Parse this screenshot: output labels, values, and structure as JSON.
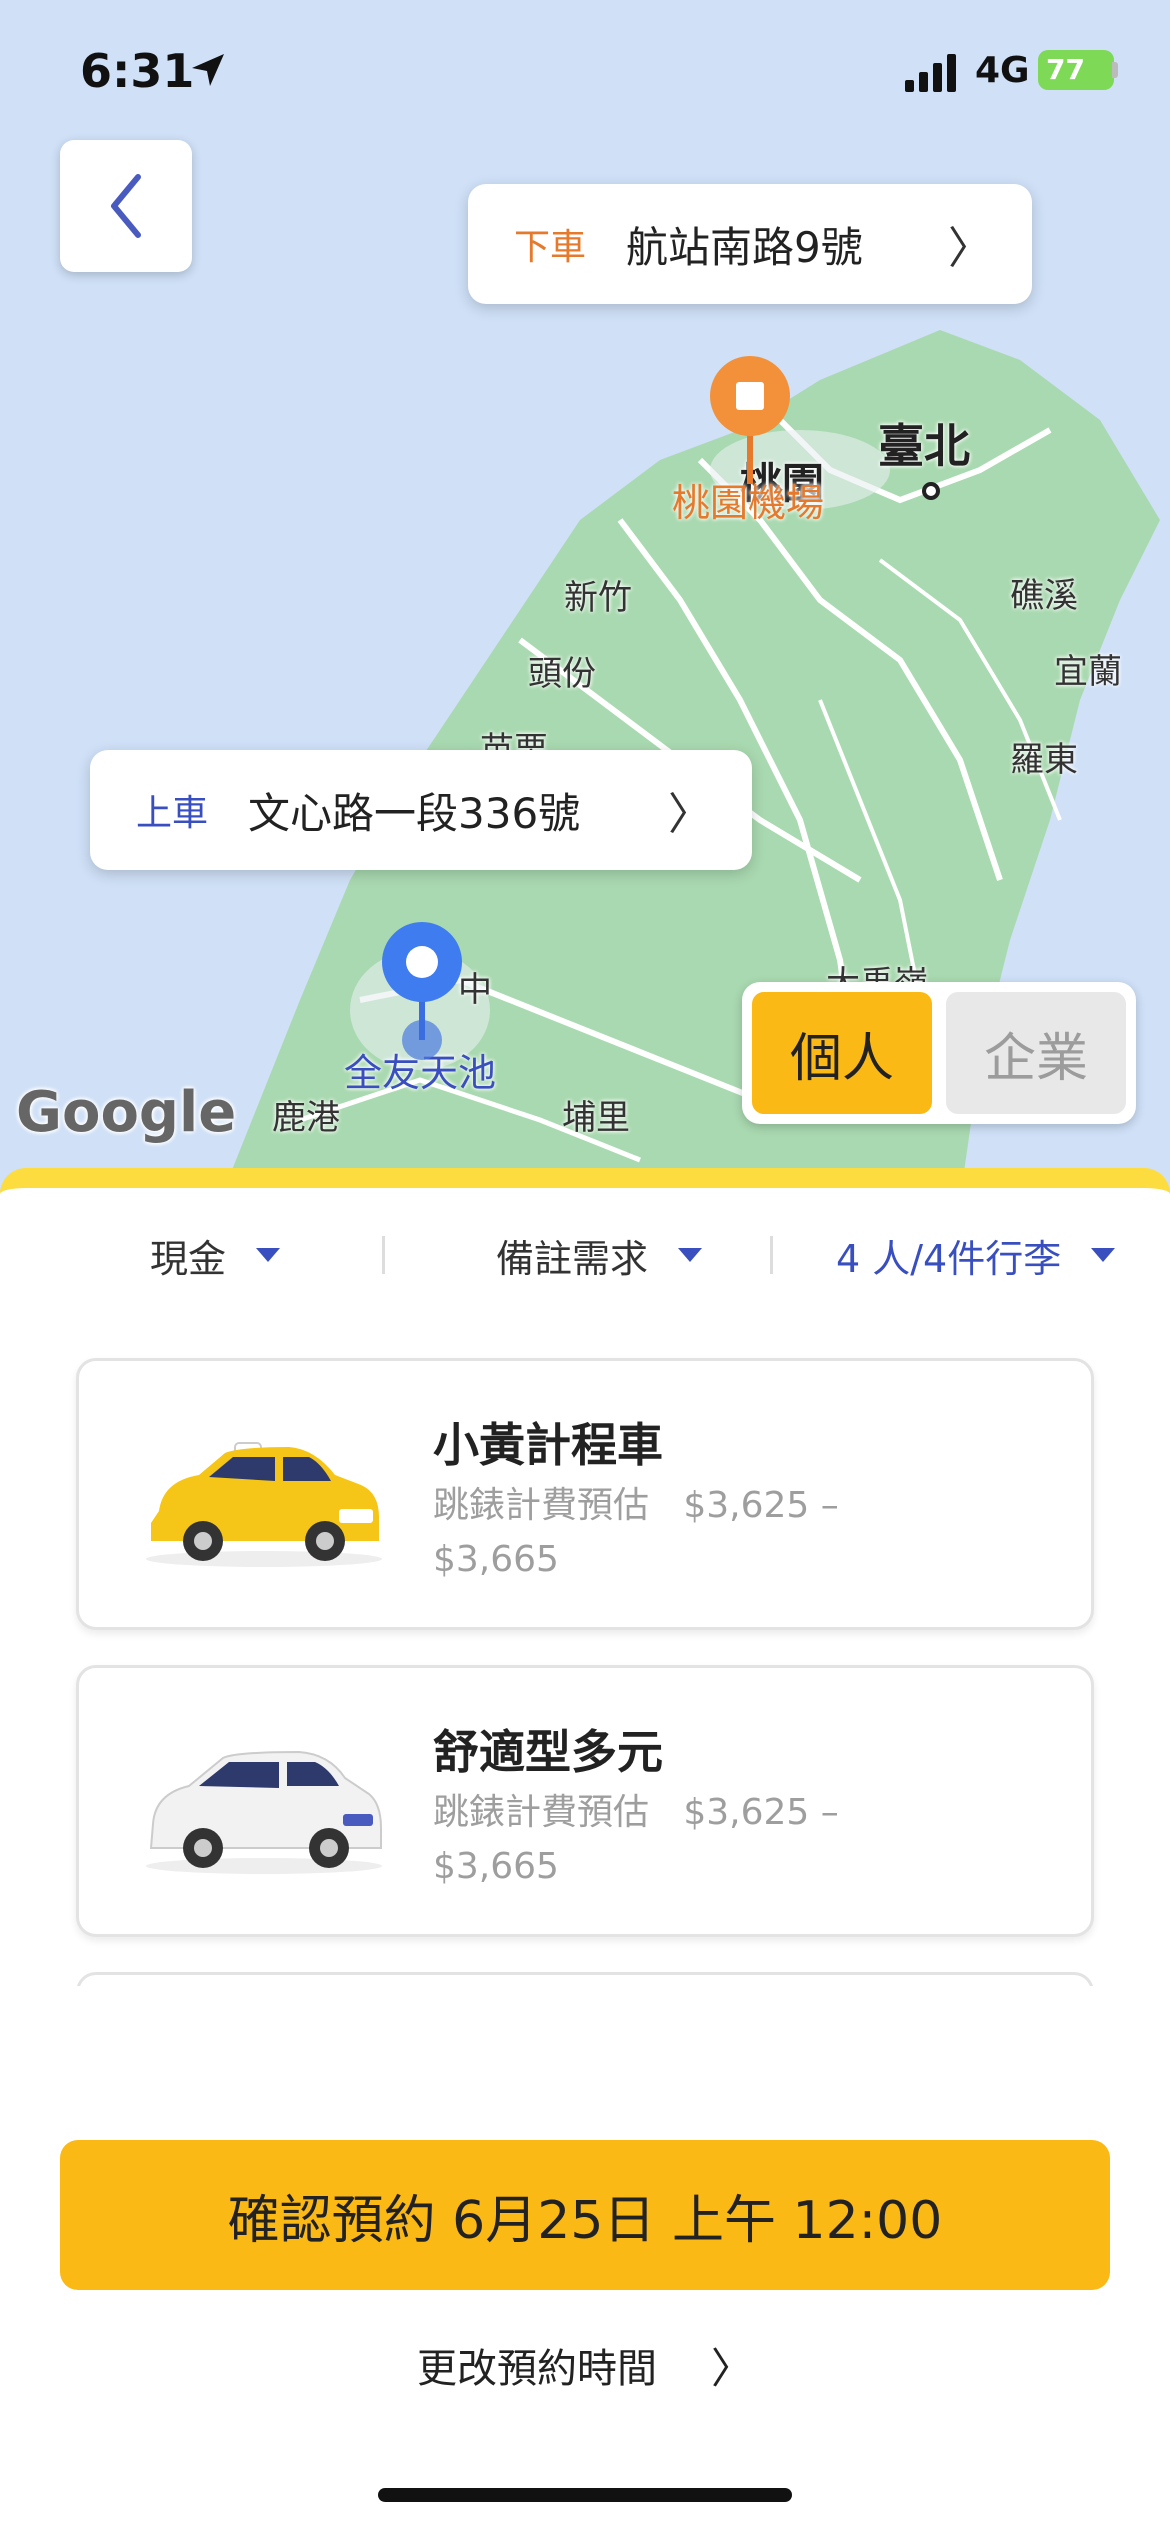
{
  "status_bar": {
    "time": "6:31",
    "network": "4G",
    "battery": "77"
  },
  "dropoff": {
    "tag": "下車",
    "address": "航站南路9號"
  },
  "pickup": {
    "tag": "上車",
    "address": "文心路一段336號"
  },
  "map": {
    "labels": {
      "taipei": "臺北",
      "taoyuan": "桃園",
      "taoyuan_airport": "桃園機場",
      "hsinchu": "新竹",
      "toufen": "頭份",
      "miaoli": "苗栗",
      "jiaoxi": "礁溪",
      "yilan": "宜蘭",
      "luodong": "羅東",
      "quanyou": "全友天池",
      "lukang": "鹿港",
      "puli": "埔里",
      "dayuguan": "大禹嶺",
      "taichung_partial": "中"
    },
    "attribution": "Google"
  },
  "account_type": {
    "personal": "個人",
    "business": "企業",
    "selected": "個人"
  },
  "filters": {
    "payment": "現金",
    "notes": "備註需求",
    "passengers": "4 人/4件行李"
  },
  "vehicles": [
    {
      "name": "小黃計程車",
      "estimate_label": "跳錶計費預估",
      "price_range": "$3,625 – $3,665"
    },
    {
      "name": "舒適型多元",
      "estimate_label": "跳錶計費預估",
      "price_range": "$3,625 – $3,665"
    }
  ],
  "confirm_button": "確認預約 6月25日 上午 12:00",
  "change_time": "更改預約時間",
  "colors": {
    "accent": "#fbb915",
    "blue": "#3a4fbf",
    "orange": "#e5792c",
    "map_land": "#a9d9b0",
    "map_water": "#cfe0f7"
  }
}
